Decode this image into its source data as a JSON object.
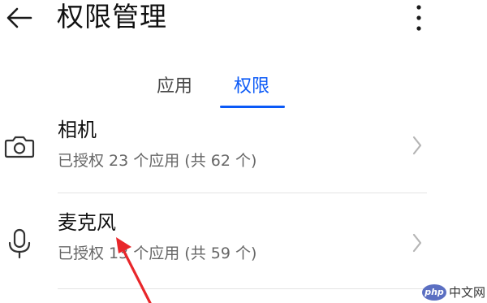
{
  "header": {
    "back_icon": "back-arrow-icon",
    "title": "权限管理",
    "more_icon": "more-vertical-icon"
  },
  "tabs": [
    {
      "label": "应用",
      "selected": false
    },
    {
      "label": "权限",
      "selected": true
    }
  ],
  "permissions": [
    {
      "icon": "camera-icon",
      "title": "相机",
      "subtitle": "已授权 23 个应用 (共 62 个)"
    },
    {
      "icon": "microphone-icon",
      "title": "麦克风",
      "subtitle": "已授权 13 个应用 (共 59 个)"
    }
  ],
  "annotation": {
    "icon": "red-arrow-icon",
    "color": "#e8262a"
  },
  "watermark": {
    "badge": "php",
    "text": "中文网"
  },
  "colors": {
    "accent": "#0a59f7",
    "title_text": "#111111",
    "secondary_text": "#666666"
  }
}
